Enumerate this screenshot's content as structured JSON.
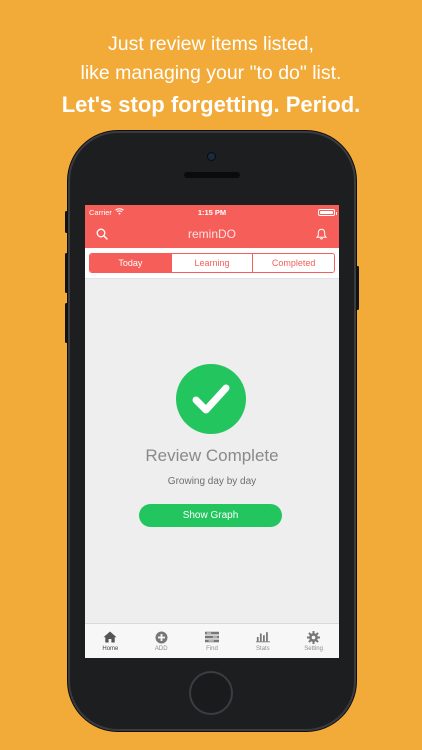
{
  "promo": {
    "line1": "Just review items listed,",
    "line2": "like managing your \"to do\" list.",
    "headline": "Let's stop forgetting. Period."
  },
  "status_bar": {
    "carrier": "Carrier",
    "time": "1:15 PM"
  },
  "nav": {
    "title": "reminDO"
  },
  "segments": [
    {
      "label": "Today",
      "active": true
    },
    {
      "label": "Learning",
      "active": false
    },
    {
      "label": "Completed",
      "active": false
    }
  ],
  "review": {
    "title": "Review Complete",
    "subtitle": "Growing day by day",
    "button": "Show Graph"
  },
  "tabs": [
    {
      "label": "Home",
      "icon": "home-icon",
      "active": true
    },
    {
      "label": "ADD",
      "icon": "add-icon",
      "active": false
    },
    {
      "label": "Find",
      "icon": "find-icon",
      "active": false
    },
    {
      "label": "Stats",
      "icon": "stats-icon",
      "active": false
    },
    {
      "label": "Setting",
      "icon": "gear-icon",
      "active": false
    }
  ],
  "colors": {
    "background": "#F2AA39",
    "accent": "#F65E5A",
    "success": "#22C55E"
  }
}
